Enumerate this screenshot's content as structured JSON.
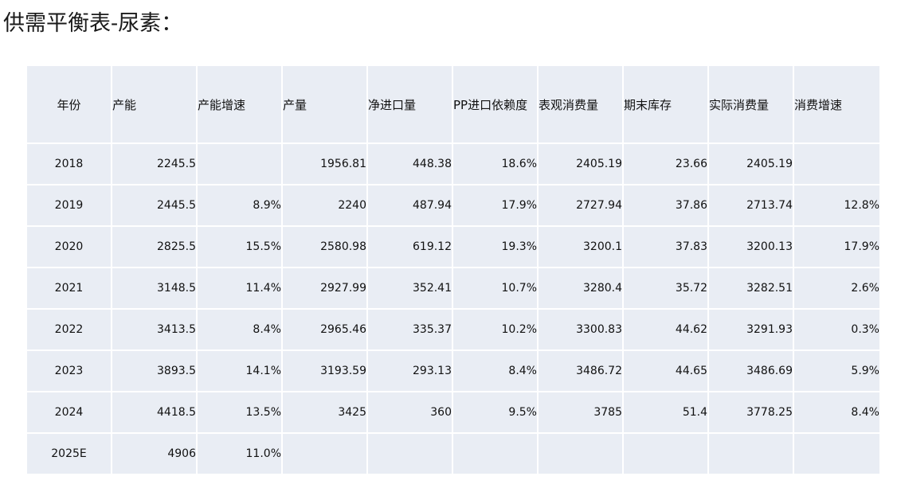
{
  "title": "供需平衡表-尿素：",
  "table": {
    "headers": [
      "年份",
      "产能",
      "产能增速",
      "产量",
      "净进口量",
      "PP进口依赖度",
      "表观消费量",
      "期末库存",
      "实际消费量",
      "消费增速"
    ],
    "rows": [
      [
        "2018",
        "2245.5",
        "",
        "1956.81",
        "448.38",
        "18.6%",
        "2405.19",
        "23.66",
        "2405.19",
        ""
      ],
      [
        "2019",
        "2445.5",
        "8.9%",
        "2240",
        "487.94",
        "17.9%",
        "2727.94",
        "37.86",
        "2713.74",
        "12.8%"
      ],
      [
        "2020",
        "2825.5",
        "15.5%",
        "2580.98",
        "619.12",
        "19.3%",
        "3200.1",
        "37.83",
        "3200.13",
        "17.9%"
      ],
      [
        "2021",
        "3148.5",
        "11.4%",
        "2927.99",
        "352.41",
        "10.7%",
        "3280.4",
        "35.72",
        "3282.51",
        "2.6%"
      ],
      [
        "2022",
        "3413.5",
        "8.4%",
        "2965.46",
        "335.37",
        "10.2%",
        "3300.83",
        "44.62",
        "3291.93",
        "0.3%"
      ],
      [
        "2023",
        "3893.5",
        "14.1%",
        "3193.59",
        "293.13",
        "8.4%",
        "3486.72",
        "44.65",
        "3486.69",
        "5.9%"
      ],
      [
        "2024",
        "4418.5",
        "13.5%",
        "3425",
        "360",
        "9.5%",
        "3785",
        "51.4",
        "3778.25",
        "8.4%"
      ],
      [
        "2025E",
        "4906",
        "11.0%",
        "",
        "",
        "",
        "",
        "",
        "",
        ""
      ]
    ]
  }
}
